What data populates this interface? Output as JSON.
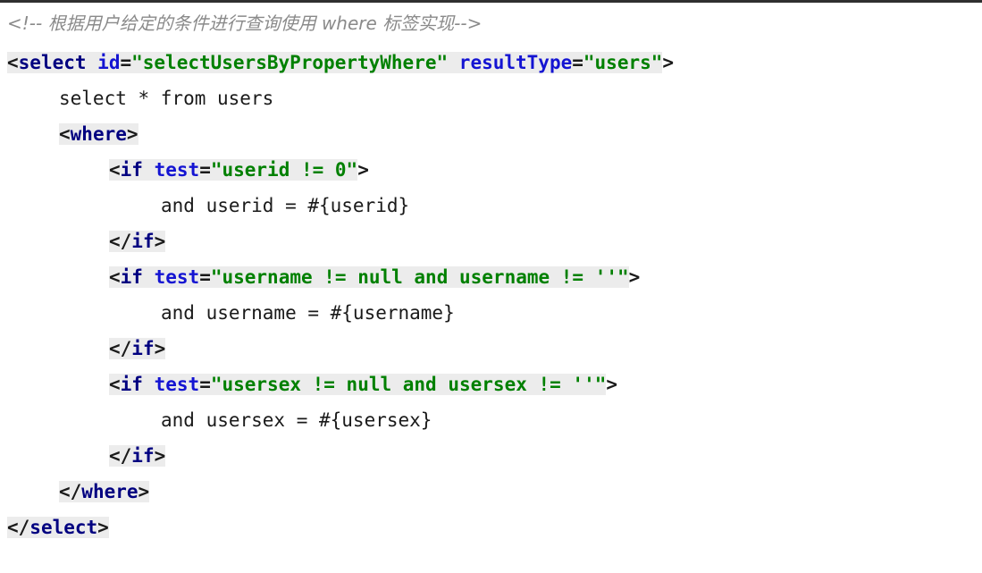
{
  "editor": {
    "language": "xml",
    "background_color": "#ffffff",
    "highlight_color": "#ececec",
    "colors": {
      "comment": "#8a8a8a",
      "tag": "#000080",
      "attribute": "#1414d2",
      "string": "#008000",
      "punctuation": "#1a1a1a",
      "plain_text": "#1a1a1a"
    }
  },
  "code": {
    "comment_line": {
      "open": "<!--",
      "text_cn": " 根据用户给定的条件进行查询使用 ",
      "keyword": "where",
      "text_cn_2": " 标签实现",
      "close": "-->"
    },
    "select_open": {
      "lt": "<",
      "tag": "select",
      "attr1": "id",
      "eq": "=",
      "value1": "\"selectUsersByPropertyWhere\"",
      "attr2": "resultType",
      "value2": "\"users\"",
      "gt": ">"
    },
    "sql_line": "select * from users",
    "where_open": {
      "lt": "<",
      "tag": "where",
      "gt": ">"
    },
    "if_userid": {
      "lt": "<",
      "tag": "if",
      "attr": "test",
      "eq": "=",
      "value": "\"userid != 0\"",
      "gt": ">"
    },
    "body_userid": "and userid = #{userid}",
    "if_close_1": {
      "lt": "</",
      "tag": "if",
      "gt": ">"
    },
    "if_username": {
      "lt": "<",
      "tag": "if",
      "attr": "test",
      "eq": "=",
      "value": "\"username != null and username != ''\"",
      "gt": ">"
    },
    "body_username": "and username = #{username}",
    "if_close_2": {
      "lt": "</",
      "tag": "if",
      "gt": ">"
    },
    "if_usersex": {
      "lt": "<",
      "tag": "if",
      "attr": "test",
      "eq": "=",
      "value": "\"usersex != null and usersex != ''\"",
      "gt": ">"
    },
    "body_usersex": "and usersex = #{usersex}",
    "if_close_3": {
      "lt": "</",
      "tag": "if",
      "gt": ">"
    },
    "where_close": {
      "lt": "</",
      "tag": "where",
      "gt": ">"
    },
    "select_close": {
      "lt": "</",
      "tag": "select",
      "gt": ">"
    }
  }
}
